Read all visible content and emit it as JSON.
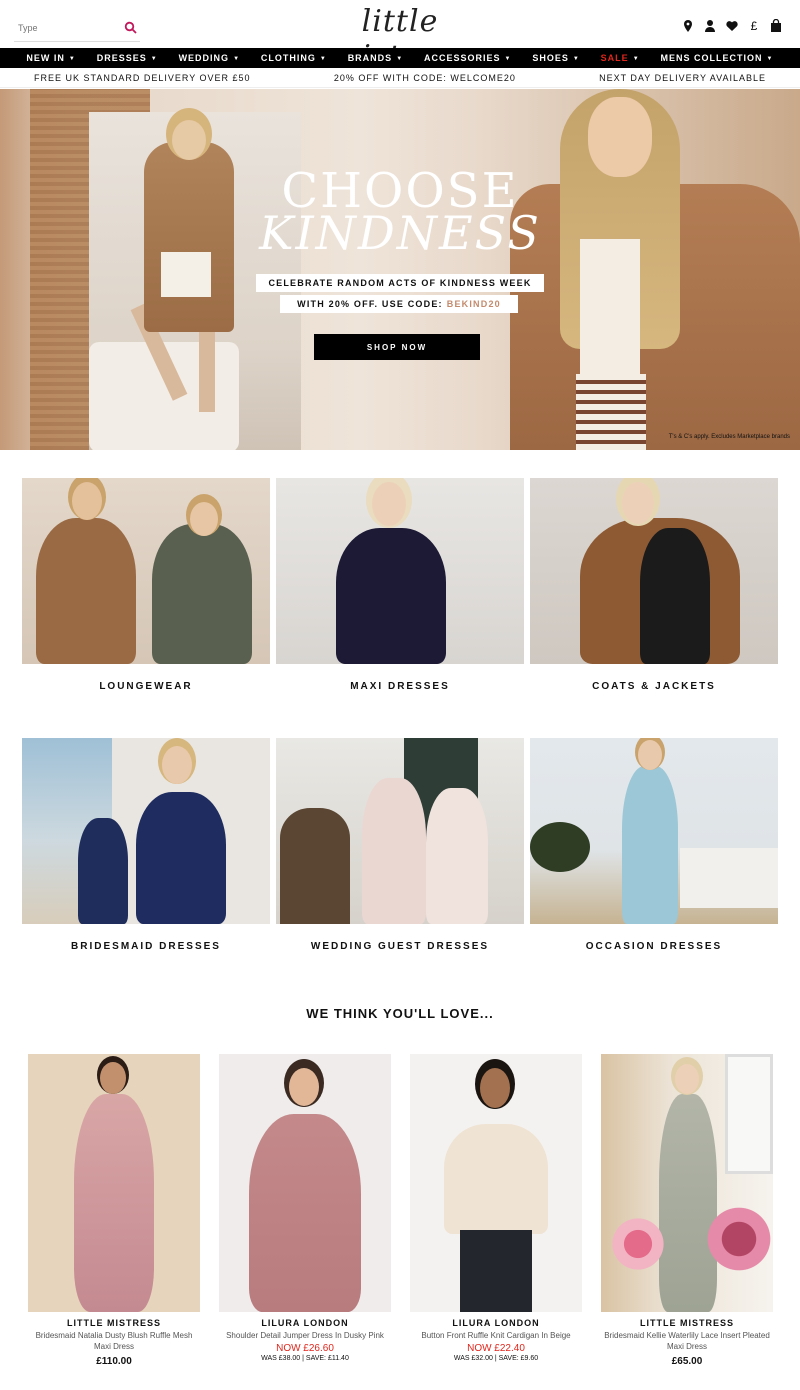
{
  "header": {
    "search_placeholder": "Type",
    "logo": "little mistress",
    "icons": [
      "location-icon",
      "account-icon",
      "heart-icon",
      "currency-icon",
      "bag-icon"
    ],
    "currency": "£"
  },
  "nav": [
    {
      "label": "NEW IN"
    },
    {
      "label": "DRESSES"
    },
    {
      "label": "WEDDING"
    },
    {
      "label": "CLOTHING"
    },
    {
      "label": "BRANDS"
    },
    {
      "label": "ACCESSORIES"
    },
    {
      "label": "SHOES"
    },
    {
      "label": "SALE"
    },
    {
      "label": "MENS COLLECTION"
    }
  ],
  "nav_colors": {
    "default": "#ffffff",
    "sale": "#e1261c"
  },
  "promo": {
    "left": "FREE UK STANDARD DELIVERY OVER £50",
    "center": "20% OFF WITH CODE: WELCOME20",
    "right": "NEXT DAY DELIVERY AVAILABLE"
  },
  "hero": {
    "title_1": "CHOOSE",
    "title_2": "KINDNESS",
    "band_1": "CELEBRATE RANDOM ACTS OF KINDNESS WEEK",
    "band_2_prefix": "WITH 20% OFF. USE CODE:",
    "band_2_code": "BEKIND20",
    "button": "SHOP NOW",
    "small_print": "T's & C's apply. Excludes Marketplace brands"
  },
  "categories": [
    {
      "label": "LOUNGEWEAR"
    },
    {
      "label": "MAXI DRESSES"
    },
    {
      "label": "COATS & JACKETS"
    },
    {
      "label": "BRIDESMAID DRESSES"
    },
    {
      "label": "WEDDING GUEST DRESSES"
    },
    {
      "label": "OCCASION DRESSES"
    }
  ],
  "recommend_title": "WE THINK YOU'LL LOVE...",
  "products": [
    {
      "brand": "LITTLE MISTRESS",
      "name": "Bridesmaid Natalia Dusty Blush Ruffle Mesh Maxi Dress",
      "price": "£110.00",
      "now": "",
      "was": ""
    },
    {
      "brand": "LILURA LONDON",
      "name": "Shoulder Detail Jumper Dress In Dusky Pink",
      "price": "",
      "now": "NOW £26.60",
      "was": "WAS £38.00 | SAVE: £11.40"
    },
    {
      "brand": "LILURA LONDON",
      "name": "Button Front Ruffle Knit Cardigan In Beige",
      "price": "",
      "now": "NOW £22.40",
      "was": "WAS £32.00 | SAVE: £9.60"
    },
    {
      "brand": "LITTLE MISTRESS",
      "name": "Bridesmaid Kellie Waterlily Lace Insert Pleated Maxi Dress",
      "price": "£65.00",
      "now": "",
      "was": ""
    }
  ]
}
